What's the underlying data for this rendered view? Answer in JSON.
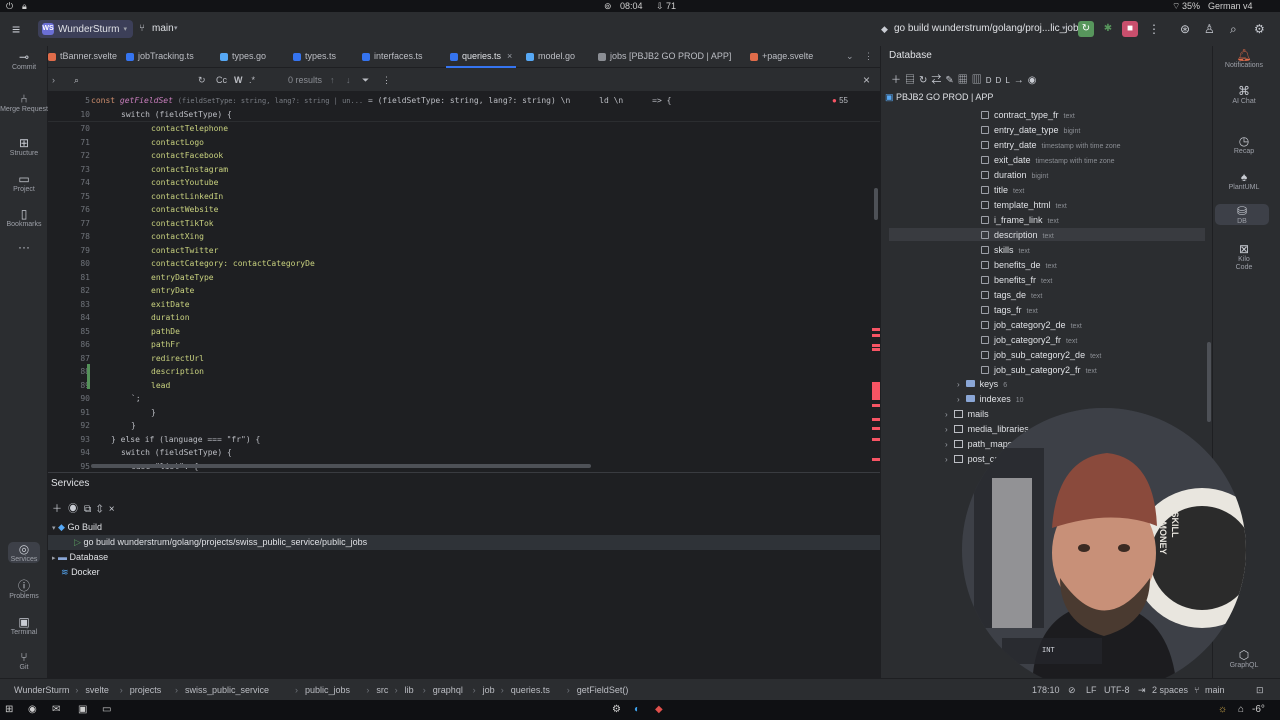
{
  "system_bar": {
    "time": "08:04",
    "downloads": "71",
    "battery": "35%",
    "keyboard": "German v4"
  },
  "titlebar": {
    "project_initials": "WS",
    "project_name": "WunderSturm",
    "branch": "main",
    "run_config": "go build wunderstrum/golang/proj...lic_jobs"
  },
  "tabs": [
    {
      "label": "tBanner.svelte",
      "color": "#e06c4a"
    },
    {
      "label": "jobTracking.ts",
      "color": "#3574f0"
    },
    {
      "label": "types.go",
      "color": "#56a8f5"
    },
    {
      "label": "types.ts",
      "color": "#3574f0"
    },
    {
      "label": "interfaces.ts",
      "color": "#3574f0"
    },
    {
      "label": "queries.ts",
      "color": "#3574f0",
      "active": true
    },
    {
      "label": "model.go",
      "color": "#56a8f5"
    },
    {
      "label": "jobs [PBJB2 GO PROD | APP]",
      "color": "#8b8e94"
    },
    {
      "label": "+page.svelte",
      "color": "#e06c4a"
    }
  ],
  "search": {
    "case": "Cc",
    "word": "W",
    "regex": ".*",
    "results": "0 results"
  },
  "editor": {
    "sticky": [
      {
        "line": "5",
        "prefix": "const ",
        "fn": "getFieldSet",
        "hint": "(fieldSetType: string, lang?: string | un...",
        "rest": " = (fieldSetType: string, lang?: string) \\n      ld \\n      => {"
      },
      {
        "line": "10",
        "text": "switch (fieldSetType) {"
      }
    ],
    "errors_badge": "55",
    "lines": [
      {
        "n": "70",
        "text": "contactTelephone"
      },
      {
        "n": "71",
        "text": "contactLogo"
      },
      {
        "n": "72",
        "text": "contactFacebook"
      },
      {
        "n": "73",
        "text": "contactInstagram"
      },
      {
        "n": "74",
        "text": "contactYoutube"
      },
      {
        "n": "75",
        "text": "contactLinkedIn"
      },
      {
        "n": "76",
        "text": "contactWebsite"
      },
      {
        "n": "77",
        "text": "contactTikTok"
      },
      {
        "n": "78",
        "text": "contactXing"
      },
      {
        "n": "79",
        "text": "contactTwitter"
      },
      {
        "n": "80",
        "text": "contactCategory: contactCategoryDe"
      },
      {
        "n": "81",
        "text": "entryDateType"
      },
      {
        "n": "82",
        "text": "entryDate"
      },
      {
        "n": "83",
        "text": "exitDate"
      },
      {
        "n": "84",
        "text": "duration"
      },
      {
        "n": "85",
        "text": "pathDe"
      },
      {
        "n": "86",
        "text": "pathFr"
      },
      {
        "n": "87",
        "text": "redirectUrl"
      },
      {
        "n": "88",
        "text": "description"
      },
      {
        "n": "89",
        "text": "lead"
      },
      {
        "n": "90",
        "text": "`;"
      },
      {
        "n": "91",
        "text": "}"
      },
      {
        "n": "92",
        "text": "}"
      },
      {
        "n": "93",
        "text": "} else if (language === \"fr\") {"
      },
      {
        "n": "94",
        "text": "switch (fieldSetType) {"
      },
      {
        "n": "95",
        "text": "case \"list\": {"
      }
    ]
  },
  "services": {
    "title": "Services",
    "tree": [
      {
        "label": "Go Build",
        "level": 1,
        "icon": "go-icon"
      },
      {
        "label": "go build wunderstrum/golang/projects/swiss_public_service/public_jobs",
        "level": 2,
        "icon": "run-icon",
        "selected": true
      },
      {
        "label": "Database",
        "level": 1,
        "icon": "folder-icon"
      },
      {
        "label": "Docker",
        "level": 1,
        "icon": "docker-icon"
      }
    ]
  },
  "database": {
    "title": "Database",
    "connection": "PBJB2 GO PROD | APP",
    "columns": [
      {
        "name": "contract_type_fr",
        "type": "text"
      },
      {
        "name": "entry_date_type",
        "type": "bigint"
      },
      {
        "name": "entry_date",
        "type": "timestamp with time zone"
      },
      {
        "name": "exit_date",
        "type": "timestamp with time zone"
      },
      {
        "name": "duration",
        "type": "bigint"
      },
      {
        "name": "title",
        "type": "text"
      },
      {
        "name": "template_html",
        "type": "text"
      },
      {
        "name": "i_frame_link",
        "type": "text"
      },
      {
        "name": "description",
        "type": "text",
        "selected": true
      },
      {
        "name": "skills",
        "type": "text"
      },
      {
        "name": "benefits_de",
        "type": "text"
      },
      {
        "name": "benefits_fr",
        "type": "text"
      },
      {
        "name": "tags_de",
        "type": "text"
      },
      {
        "name": "tags_fr",
        "type": "text"
      },
      {
        "name": "job_category2_de",
        "type": "text"
      },
      {
        "name": "job_category2_fr",
        "type": "text"
      },
      {
        "name": "job_sub_category2_de",
        "type": "text"
      },
      {
        "name": "job_sub_category2_fr",
        "type": "text"
      }
    ],
    "folders": [
      {
        "name": "keys",
        "count": "6"
      },
      {
        "name": "indexes",
        "count": "10"
      }
    ],
    "tables": [
      "mails",
      "media_libraries",
      "path_maps",
      "post_categories"
    ]
  },
  "left_tools": [
    {
      "label": "Commit",
      "icon": "commit-icon"
    },
    {
      "label": "Merge Request",
      "icon": "merge-request-icon"
    },
    {
      "label": "Structure",
      "icon": "structure-icon"
    },
    {
      "label": "Project",
      "icon": "project-icon"
    },
    {
      "label": "Bookmarks",
      "icon": "bookmark-icon"
    },
    {
      "label": "Services",
      "icon": "services-icon"
    },
    {
      "label": "Problems",
      "icon": "problems-icon"
    },
    {
      "label": "Terminal",
      "icon": "terminal-icon"
    },
    {
      "label": "Git",
      "icon": "git-icon"
    }
  ],
  "right_tools": [
    {
      "label": "Notifications",
      "icon": "bell-icon"
    },
    {
      "label": "AI Chat",
      "icon": "ai-chat-icon"
    },
    {
      "label": "Recap",
      "icon": "recap-icon"
    },
    {
      "label": "PlantUML",
      "icon": "plantuml-icon"
    },
    {
      "label": "DB",
      "icon": "database-icon"
    },
    {
      "label": "Kilo Code",
      "icon": "kilo-code-icon"
    },
    {
      "label": "GraphQL",
      "icon": "graphql-icon"
    }
  ],
  "statusbar": {
    "breadcrumb": [
      "WunderSturm",
      "svelte",
      "projects",
      "swiss_public_service",
      "public_jobs",
      "src",
      "lib",
      "graphql",
      "job",
      "queries.ts",
      "getFieldSet()"
    ],
    "position": "178:10",
    "line_ending": "LF",
    "encoding": "UTF-8",
    "indent": "2 spaces",
    "branch": "main"
  },
  "taskbar": {
    "weather": "-6°"
  },
  "webcam": {
    "sign_lines": [
      "NOSKILL",
      "NOMONEY"
    ],
    "screen_text": "INT"
  }
}
